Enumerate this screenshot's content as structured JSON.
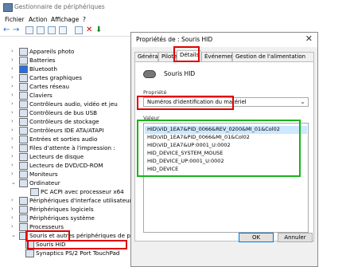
{
  "window": {
    "title": "Gestionnaire de périphériques"
  },
  "menu": [
    "Fichier",
    "Action",
    "Affichage",
    "?"
  ],
  "toolbar": {
    "icons": [
      "back-arrow-icon",
      "forward-arrow-icon",
      "properties-icon",
      "help-icon",
      "scan-icon",
      "monitor-icon",
      "remove-icon",
      "update-driver-icon"
    ]
  },
  "tree": {
    "items": [
      {
        "label": "Appareils photo",
        "icon": "camera-icon"
      },
      {
        "label": "Batteries",
        "icon": "battery-icon"
      },
      {
        "label": "Bluetooth",
        "icon": "bluetooth-icon"
      },
      {
        "label": "Cartes graphiques",
        "icon": "display-adapter-icon"
      },
      {
        "label": "Cartes réseau",
        "icon": "network-icon"
      },
      {
        "label": "Claviers",
        "icon": "keyboard-icon"
      },
      {
        "label": "Contrôleurs audio, vidéo et jeu",
        "icon": "audio-icon"
      },
      {
        "label": "Contrôleurs de bus USB",
        "icon": "usb-icon"
      },
      {
        "label": "Contrôleurs de stockage",
        "icon": "storage-icon"
      },
      {
        "label": "Contrôleurs IDE ATA/ATAPI",
        "icon": "ide-icon"
      },
      {
        "label": "Entrées et sorties audio",
        "icon": "speaker-icon"
      },
      {
        "label": "Files d'attente à l'impression :",
        "icon": "printer-icon"
      },
      {
        "label": "Lecteurs de disque",
        "icon": "disk-icon"
      },
      {
        "label": "Lecteurs de DVD/CD-ROM",
        "icon": "dvd-icon"
      },
      {
        "label": "Moniteurs",
        "icon": "monitor-icon"
      },
      {
        "label": "Ordinateur",
        "icon": "computer-icon"
      },
      {
        "label": "PC ACPI avec processeur x64",
        "icon": "computer-icon"
      },
      {
        "label": "Périphériques d'interface utilisateur",
        "icon": "hid-icon"
      },
      {
        "label": "Périphériques logiciels",
        "icon": "software-device-icon"
      },
      {
        "label": "Périphériques système",
        "icon": "system-icon"
      },
      {
        "label": "Processeurs",
        "icon": "cpu-icon"
      },
      {
        "label": "Souris et autres périphériques de pointag",
        "icon": "mouse-icon"
      },
      {
        "label": "Souris HID",
        "icon": "mouse-icon"
      },
      {
        "label": "Synaptics PS/2 Port TouchPad",
        "icon": "mouse-icon"
      }
    ]
  },
  "dialog": {
    "title": "Propriétés de : Souris HID",
    "close": "✕",
    "tabs": [
      "Général",
      "Pilote",
      "Détails",
      "Événements",
      "Gestion de l'alimentation"
    ],
    "device_name": "Souris HID",
    "property_label": "Propriété",
    "property_value": "Numéros d'identification du matériel",
    "value_label": "Valeur",
    "values": [
      "HID\\VID_1EA7&PID_0066&REV_0200&MI_01&Col02",
      "HID\\VID_1EA7&PID_0066&MI_01&Col02",
      "HID\\VID_1EA7&UP:0001_U:0002",
      "HID_DEVICE_SYSTEM_MOUSE",
      "HID_DEVICE_UP:0001_U:0002",
      "HID_DEVICE"
    ],
    "ok": "OK",
    "cancel": "Annuler"
  },
  "highlight_colors": {
    "red": "#e00000",
    "green": "#18b418",
    "selection": "#cde8ff"
  }
}
